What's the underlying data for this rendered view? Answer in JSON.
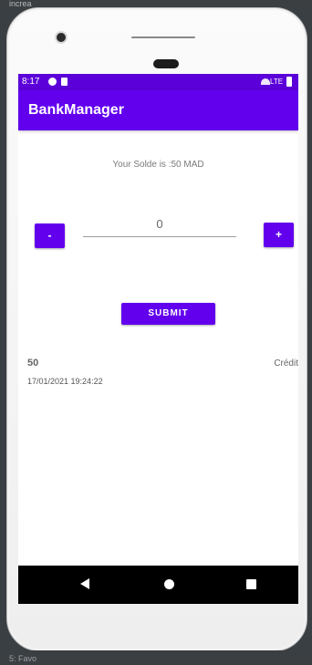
{
  "ide": {
    "top_text": "increa",
    "bottom_text": "5: Favo"
  },
  "statusbar": {
    "time": "8:17",
    "network": "LTE"
  },
  "appbar": {
    "title": "BankManager"
  },
  "main": {
    "solde_text": "Your Solde is :50 MAD",
    "minus_label": "-",
    "plus_label": "+",
    "amount_value": "0",
    "submit_label": "SUBMIT"
  },
  "transactions": [
    {
      "amount": "50",
      "type": "Crédit",
      "date": "17/01/2021 19:24:22"
    }
  ],
  "colors": {
    "primary": "#6200ee",
    "status_bar": "#5b00d9",
    "nav_bar": "#000000"
  },
  "icons": {
    "nav_back": "back-triangle-icon",
    "nav_home": "home-circle-icon",
    "nav_recent": "recent-square-icon"
  }
}
